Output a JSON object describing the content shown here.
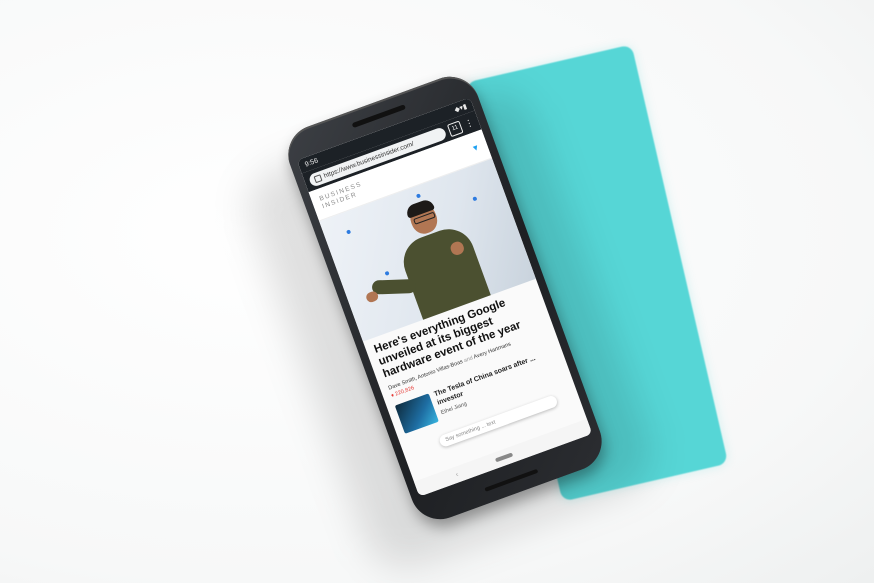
{
  "colors": {
    "background": "#ffffff",
    "teal_card": "#56d6d6",
    "phone_body": "#1e2023"
  },
  "phone": {
    "status": {
      "time": "9:56",
      "right_icons": "◆▾▮"
    },
    "browser": {
      "url": "https://www.businessinsider.com/",
      "tab_count": "11",
      "menu_icon": "more-vert-icon"
    },
    "site": {
      "brand_line1": "BUSINESS",
      "brand_line2": "INSIDER",
      "share_icon": "twitter-icon"
    },
    "article": {
      "headline": "Here's everything Google unveiled at its biggest hardware event of the year",
      "author1": "Dave Smith",
      "author2": "Antonio Villas-Boas",
      "and": "and",
      "author3": "Avery Hartmans",
      "views": "♦ 220,826"
    },
    "next_story": {
      "title": "The Tesla of China soars after ... investor",
      "author": "Ethel Jiang"
    },
    "assistant_hint": "Say something ... text"
  }
}
